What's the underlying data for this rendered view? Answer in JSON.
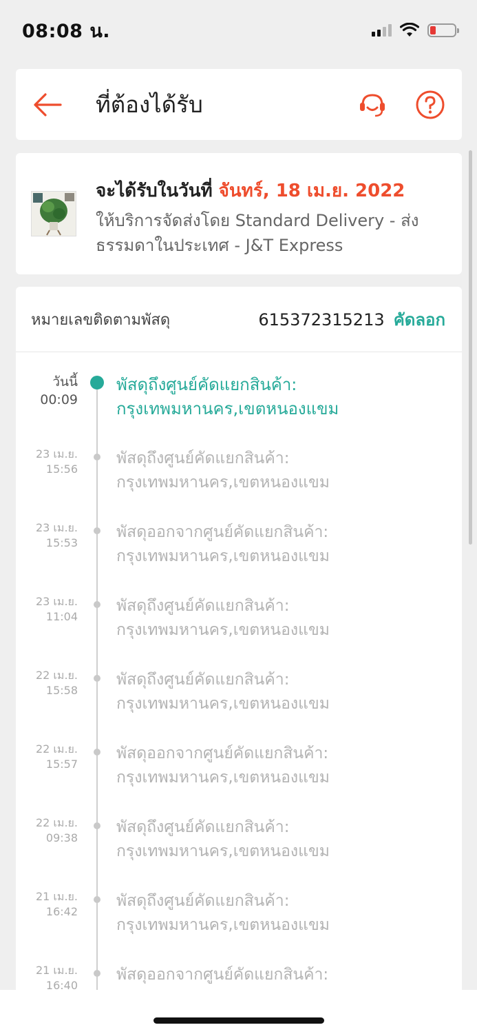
{
  "status_bar": {
    "time": "08:08 น."
  },
  "header": {
    "title": "ที่ต้องได้รับ"
  },
  "delivery": {
    "eta_prefix": "จะได้รับในวันที่",
    "eta_date": "จันทร์, 18 เม.ย. 2022",
    "carrier_text": "ให้บริการจัดส่งโดย Standard Delivery - ส่งธรรมดาในประเทศ - J&T Express"
  },
  "tracking": {
    "label": "หมายเลขติดตามพัสดุ",
    "number": "615372315213",
    "copy_label": "คัดลอก",
    "events": [
      {
        "date": "วันนี้",
        "time": "00:09",
        "status": "พัสดุถึงศูนย์คัดแยกสินค้า:",
        "location": "กรุงเทพมหานคร,เขตหนองแขม"
      },
      {
        "date": "23 เม.ย.",
        "time": "15:56",
        "status": "พัสดุถึงศูนย์คัดแยกสินค้า:",
        "location": "กรุงเทพมหานคร,เขตหนองแขม"
      },
      {
        "date": "23 เม.ย.",
        "time": "15:53",
        "status": "พัสดุออกจากศูนย์คัดแยกสินค้า:",
        "location": "กรุงเทพมหานคร,เขตหนองแขม"
      },
      {
        "date": "23 เม.ย.",
        "time": "11:04",
        "status": "พัสดุถึงศูนย์คัดแยกสินค้า:",
        "location": "กรุงเทพมหานคร,เขตหนองแขม"
      },
      {
        "date": "22 เม.ย.",
        "time": "15:58",
        "status": "พัสดุถึงศูนย์คัดแยกสินค้า:",
        "location": "กรุงเทพมหานคร,เขตหนองแขม"
      },
      {
        "date": "22 เม.ย.",
        "time": "15:57",
        "status": "พัสดุออกจากศูนย์คัดแยกสินค้า:",
        "location": "กรุงเทพมหานคร,เขตหนองแขม"
      },
      {
        "date": "22 เม.ย.",
        "time": "09:38",
        "status": "พัสดุถึงศูนย์คัดแยกสินค้า:",
        "location": "กรุงเทพมหานคร,เขตหนองแขม"
      },
      {
        "date": "21 เม.ย.",
        "time": "16:42",
        "status": "พัสดุถึงศูนย์คัดแยกสินค้า:",
        "location": "กรุงเทพมหานคร,เขตหนองแขม"
      },
      {
        "date": "21 เม.ย.",
        "time": "16:40",
        "status": "พัสดุออกจากศูนย์คัดแยกสินค้า:",
        "location": ""
      }
    ]
  },
  "icons": {
    "back": "arrow-left-icon",
    "support": "headset-icon",
    "help": "question-circle-icon"
  },
  "colors": {
    "brand": "#ee4d2d",
    "accent": "#26aa99",
    "muted": "#b3b3b3"
  }
}
